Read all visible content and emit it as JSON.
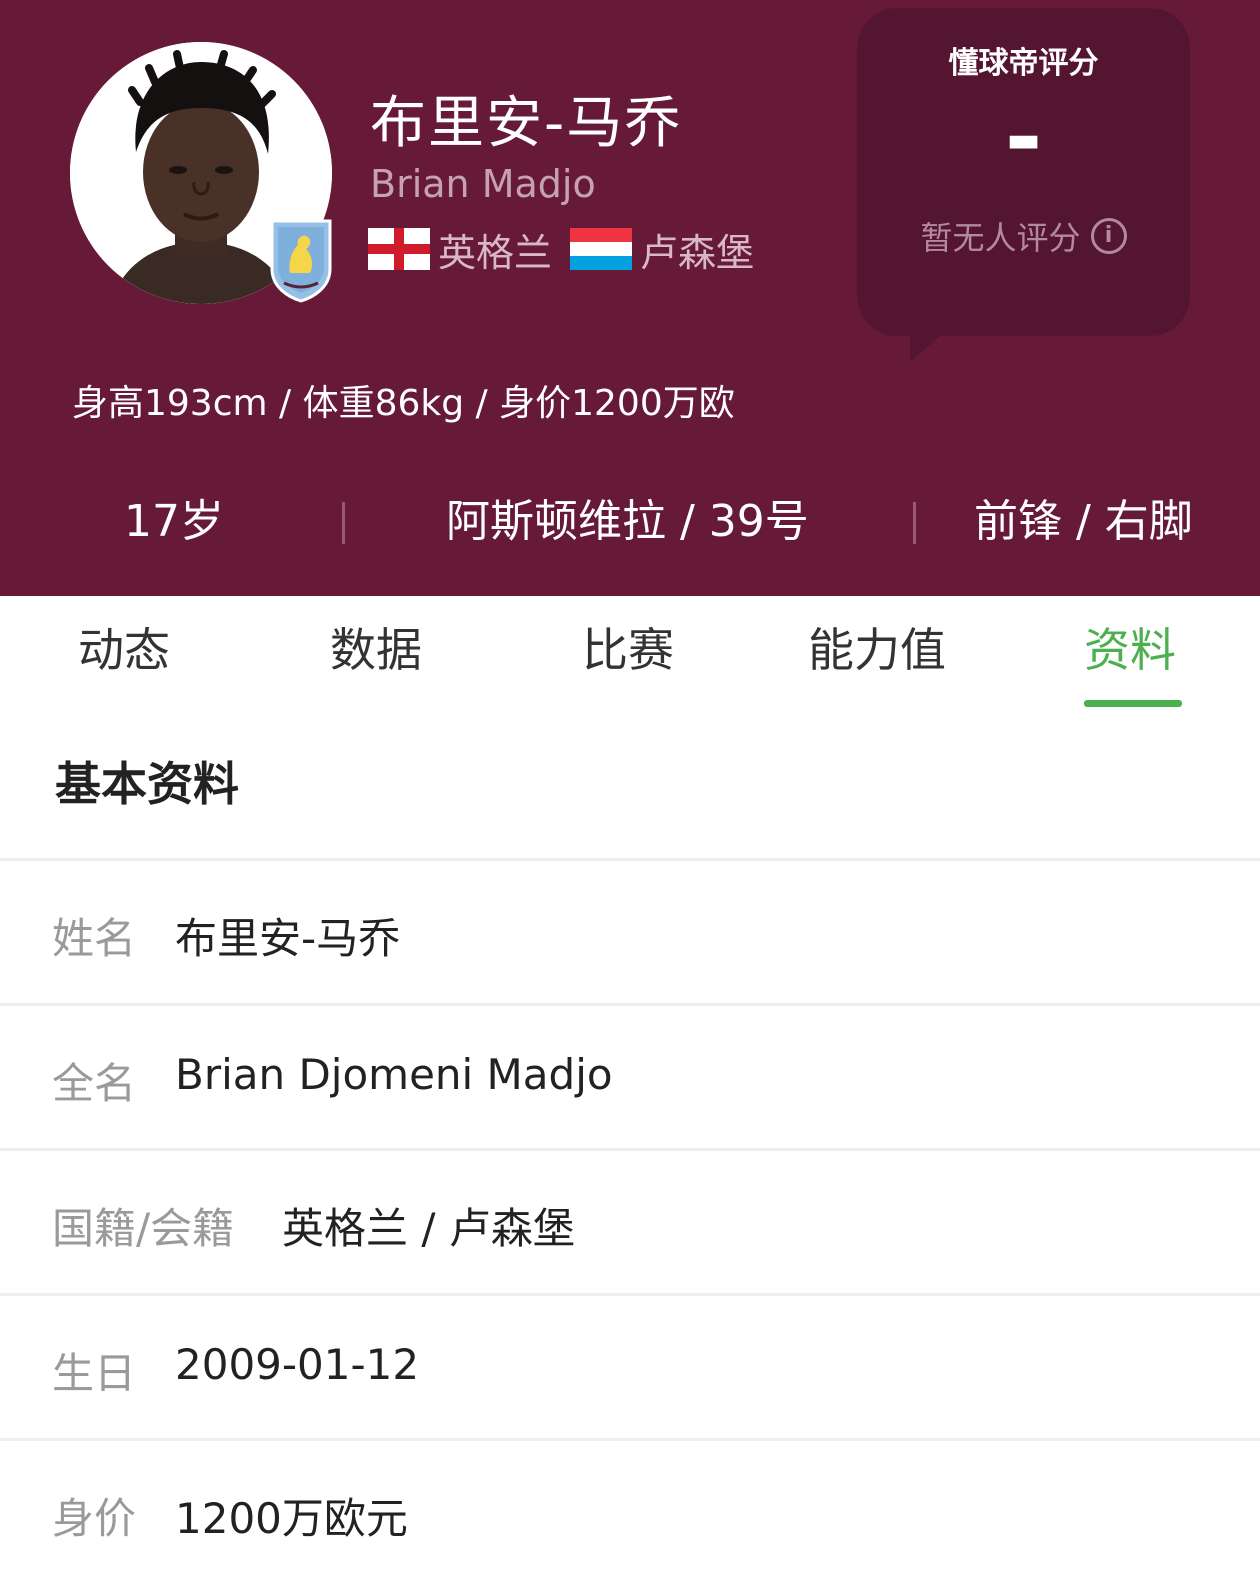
{
  "player": {
    "name_cn": "布里安-马乔",
    "name_en": "Brian Madjo",
    "nationalities": [
      {
        "flag": "england-flag",
        "label": "英格兰"
      },
      {
        "flag": "luxembourg-flag",
        "label": "卢森堡"
      }
    ],
    "body_stats": "身高193cm / 体重86kg / 身价1200万欧"
  },
  "rating": {
    "title": "懂球帝评分",
    "value": "-",
    "note": "暂无人评分"
  },
  "summary": {
    "age": "17岁",
    "club_number": "阿斯顿维拉 / 39号",
    "position_foot": "前锋 / 右脚"
  },
  "tabs": [
    {
      "label": "动态",
      "active": false
    },
    {
      "label": "数据",
      "active": false
    },
    {
      "label": "比赛",
      "active": false
    },
    {
      "label": "能力值",
      "active": false
    },
    {
      "label": "资料",
      "active": true
    }
  ],
  "section": {
    "title": "基本资料",
    "rows": [
      {
        "label": "姓名",
        "value": "布里安-马乔"
      },
      {
        "label": "全名",
        "value": "Brian Djomeni Madjo"
      },
      {
        "label": "国籍/会籍",
        "value": "英格兰 / 卢森堡"
      },
      {
        "label": "生日",
        "value": "2009-01-12"
      },
      {
        "label": "身价",
        "value": "1200万欧元"
      }
    ]
  },
  "colors": {
    "header_bg": "#661a37",
    "rating_bg": "#541531",
    "accent_green": "#4caf50"
  }
}
